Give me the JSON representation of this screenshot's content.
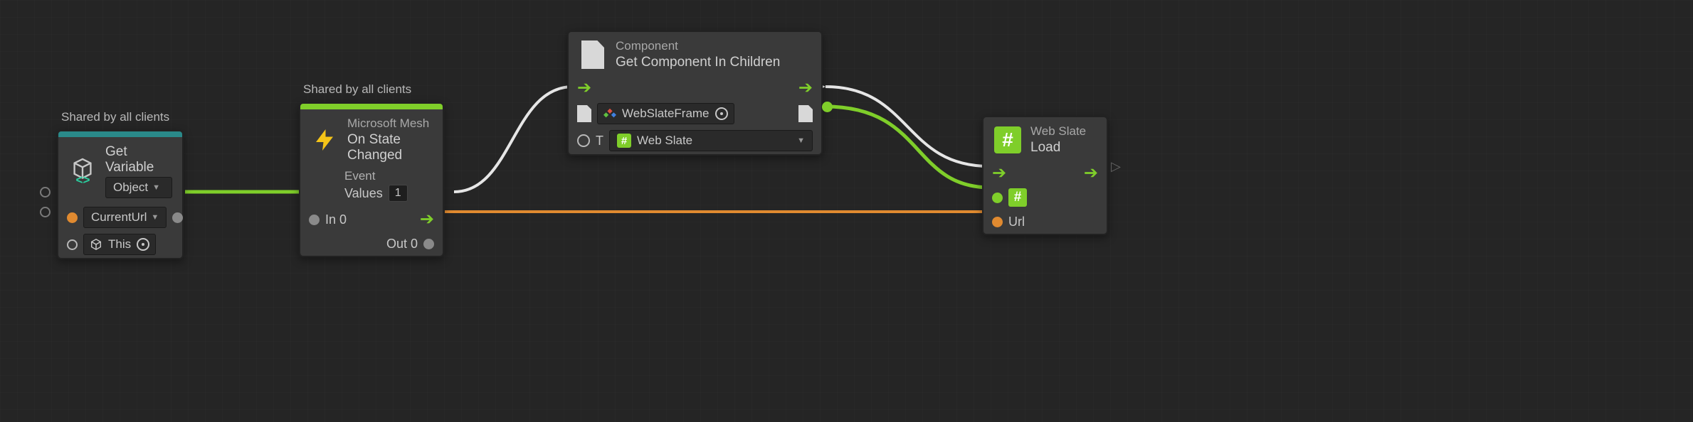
{
  "shared_label": "Shared by all clients",
  "colors": {
    "flow": "#7fce2a",
    "orange": "#e08a30",
    "white": "#e6e6e6"
  },
  "nodes": {
    "get_variable": {
      "title": "Get Variable",
      "kind_selector": "Object",
      "name_field": "CurrentUrl",
      "target_field": "This"
    },
    "on_state_changed": {
      "category": "Microsoft Mesh",
      "title": "On State Changed",
      "section": "Event",
      "values_label": "Values",
      "values_count": "1",
      "in_label": "In 0",
      "out_label": "Out 0"
    },
    "get_component": {
      "category": "Component",
      "title": "Get Component In Children",
      "target_value": "WebSlateFrame",
      "type_label": "T",
      "type_value": "Web Slate"
    },
    "load": {
      "category": "Web Slate",
      "title": "Load",
      "url_label": "Url"
    }
  }
}
